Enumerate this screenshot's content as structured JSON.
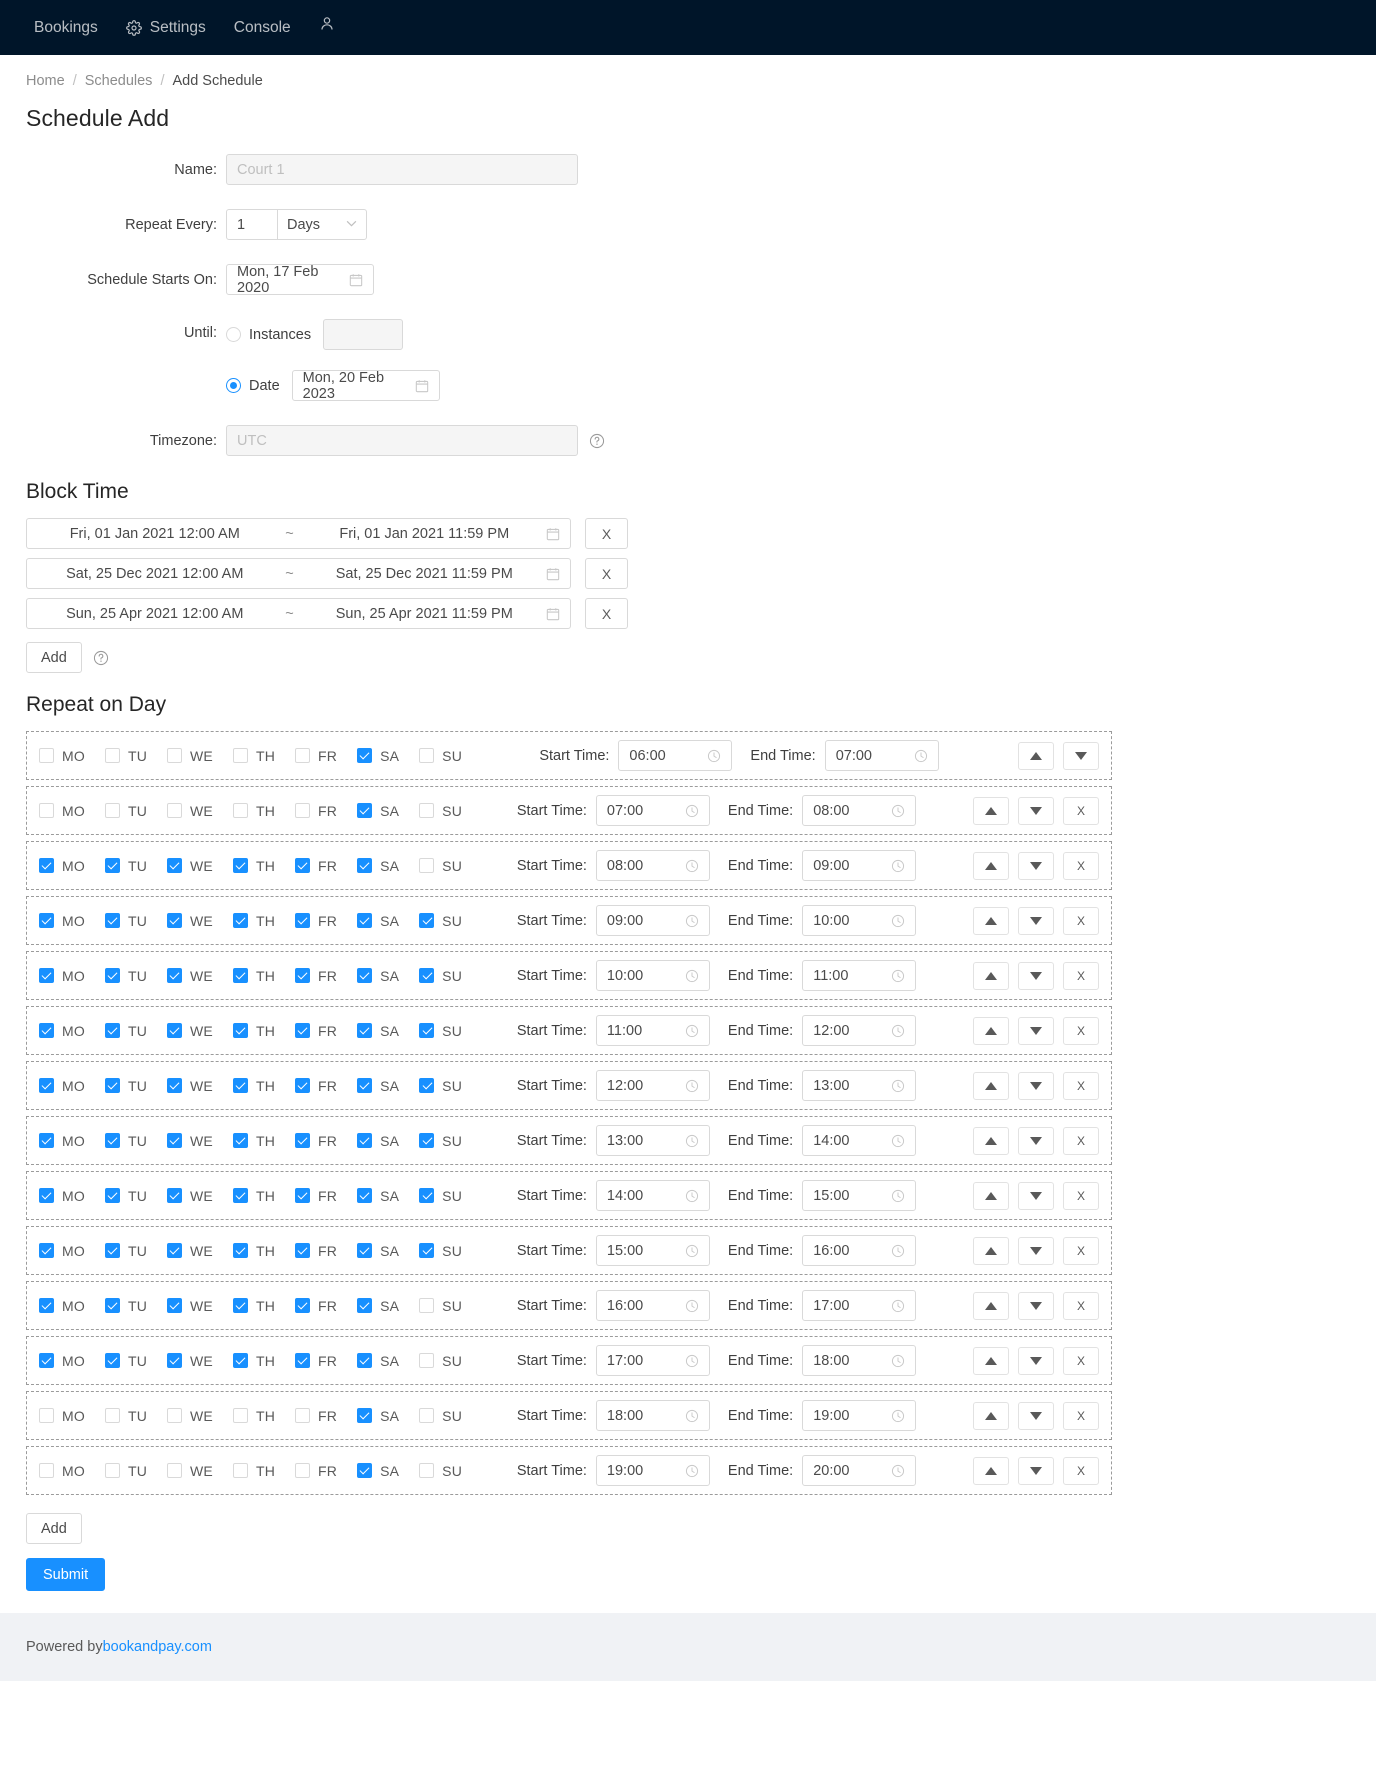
{
  "nav": {
    "items": [
      {
        "label": "Bookings",
        "icon": null
      },
      {
        "label": "Settings",
        "icon": "gear-icon"
      },
      {
        "label": "Console",
        "icon": null
      }
    ],
    "account_icon": "user-icon"
  },
  "breadcrumb": {
    "home": "Home",
    "schedules": "Schedules",
    "current": "Add Schedule",
    "separator": "/"
  },
  "page_title": "Schedule Add",
  "form": {
    "name": {
      "label": "Name",
      "placeholder": "Court 1",
      "value": ""
    },
    "repeat_every": {
      "label": "Repeat Every",
      "value": "1",
      "unit": "Days",
      "chevron": "chevron-down-icon"
    },
    "schedule_starts_on": {
      "label": "Schedule Starts On",
      "value": "Mon, 17 Feb 2020",
      "icon": "calendar-icon"
    },
    "until": {
      "label": "Until",
      "instances": {
        "label": "Instances",
        "selected": false,
        "value": "",
        "placeholder": ""
      },
      "date": {
        "label": "Date",
        "selected": true,
        "value": "Mon, 20 Feb 2023",
        "icon": "calendar-icon"
      }
    },
    "timezone": {
      "label": "Timezone",
      "placeholder": "UTC",
      "value": "",
      "help_icon": "question-circle-icon"
    }
  },
  "block_time": {
    "title": "Block Time",
    "separator": "~",
    "rows": [
      {
        "start": "Fri, 01 Jan 2021 12:00 AM",
        "end": "Fri, 01 Jan 2021 11:59 PM",
        "remove_label": "X"
      },
      {
        "start": "Sat, 25 Dec 2021 12:00 AM",
        "end": "Sat, 25 Dec 2021 11:59 PM",
        "remove_label": "X"
      },
      {
        "start": "Sun, 25 Apr 2021 12:00 AM",
        "end": "Sun, 25 Apr 2021 11:59 PM",
        "remove_label": "X"
      }
    ],
    "add_label": "Add",
    "help_icon": "question-circle-icon"
  },
  "repeat_on_day": {
    "title": "Repeat on Day",
    "day_names": [
      "MO",
      "TU",
      "WE",
      "TH",
      "FR",
      "SA",
      "SU"
    ],
    "start_time_label": "Start Time",
    "end_time_label": "End Time",
    "move_up_label": "move-up",
    "move_down_label": "move-down",
    "remove_label": "X",
    "rows": [
      {
        "days": [
          false,
          false,
          false,
          false,
          false,
          true,
          false
        ],
        "start": "06:00",
        "end": "07:00",
        "removable": false
      },
      {
        "days": [
          false,
          false,
          false,
          false,
          false,
          true,
          false
        ],
        "start": "07:00",
        "end": "08:00",
        "removable": true
      },
      {
        "days": [
          true,
          true,
          true,
          true,
          true,
          true,
          false
        ],
        "start": "08:00",
        "end": "09:00",
        "removable": true
      },
      {
        "days": [
          true,
          true,
          true,
          true,
          true,
          true,
          true
        ],
        "start": "09:00",
        "end": "10:00",
        "removable": true
      },
      {
        "days": [
          true,
          true,
          true,
          true,
          true,
          true,
          true
        ],
        "start": "10:00",
        "end": "11:00",
        "removable": true
      },
      {
        "days": [
          true,
          true,
          true,
          true,
          true,
          true,
          true
        ],
        "start": "11:00",
        "end": "12:00",
        "removable": true
      },
      {
        "days": [
          true,
          true,
          true,
          true,
          true,
          true,
          true
        ],
        "start": "12:00",
        "end": "13:00",
        "removable": true
      },
      {
        "days": [
          true,
          true,
          true,
          true,
          true,
          true,
          true
        ],
        "start": "13:00",
        "end": "14:00",
        "removable": true
      },
      {
        "days": [
          true,
          true,
          true,
          true,
          true,
          true,
          true
        ],
        "start": "14:00",
        "end": "15:00",
        "removable": true
      },
      {
        "days": [
          true,
          true,
          true,
          true,
          true,
          true,
          true
        ],
        "start": "15:00",
        "end": "16:00",
        "removable": true
      },
      {
        "days": [
          true,
          true,
          true,
          true,
          true,
          true,
          false
        ],
        "start": "16:00",
        "end": "17:00",
        "removable": true
      },
      {
        "days": [
          true,
          true,
          true,
          true,
          true,
          true,
          false
        ],
        "start": "17:00",
        "end": "18:00",
        "removable": true
      },
      {
        "days": [
          false,
          false,
          false,
          false,
          false,
          true,
          false
        ],
        "start": "18:00",
        "end": "19:00",
        "removable": true
      },
      {
        "days": [
          false,
          false,
          false,
          false,
          false,
          true,
          false
        ],
        "start": "19:00",
        "end": "20:00",
        "removable": true
      }
    ],
    "add_label": "Add"
  },
  "submit_label": "Submit",
  "footer": {
    "prefix": "Powered by ",
    "link": "bookandpay.com"
  },
  "colors": {
    "nav_bg": "#001529",
    "accent": "#1890ff",
    "footer_bg": "#f0f2f5",
    "disabled_bg": "#f5f5f5"
  }
}
